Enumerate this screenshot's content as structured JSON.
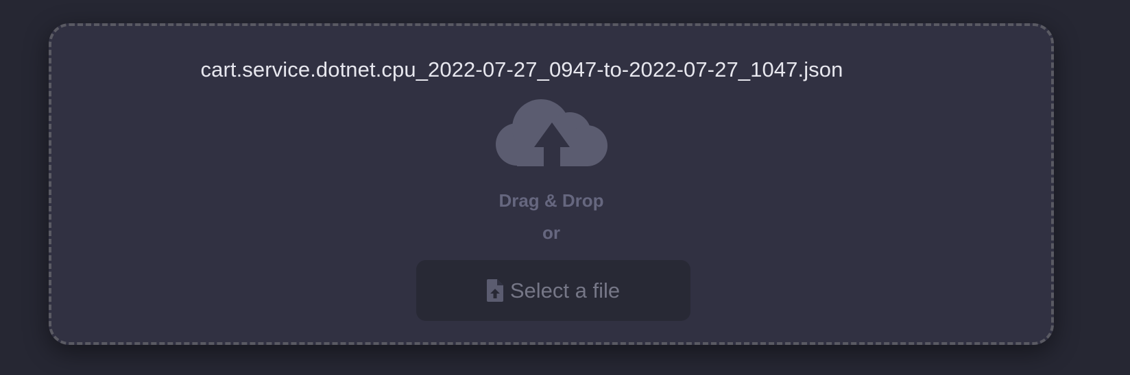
{
  "dropzone": {
    "filename": "cart.service.dotnet.cpu_2022-07-27_0947-to-2022-07-27_1047.json",
    "cloud_icon": "cloud-upload-icon",
    "drag_text": "Drag & Drop",
    "or_text": "or",
    "select_button": {
      "icon": "file-upload-icon",
      "label": "Select a file"
    }
  },
  "colors": {
    "background": "#262733",
    "panel": "#313142",
    "border": "#5a5a63",
    "filename_text": "#e7e7ee",
    "muted_text": "#66677f",
    "icon": "#5b5c70",
    "button_bg": "#282935",
    "button_text": "#767787"
  }
}
